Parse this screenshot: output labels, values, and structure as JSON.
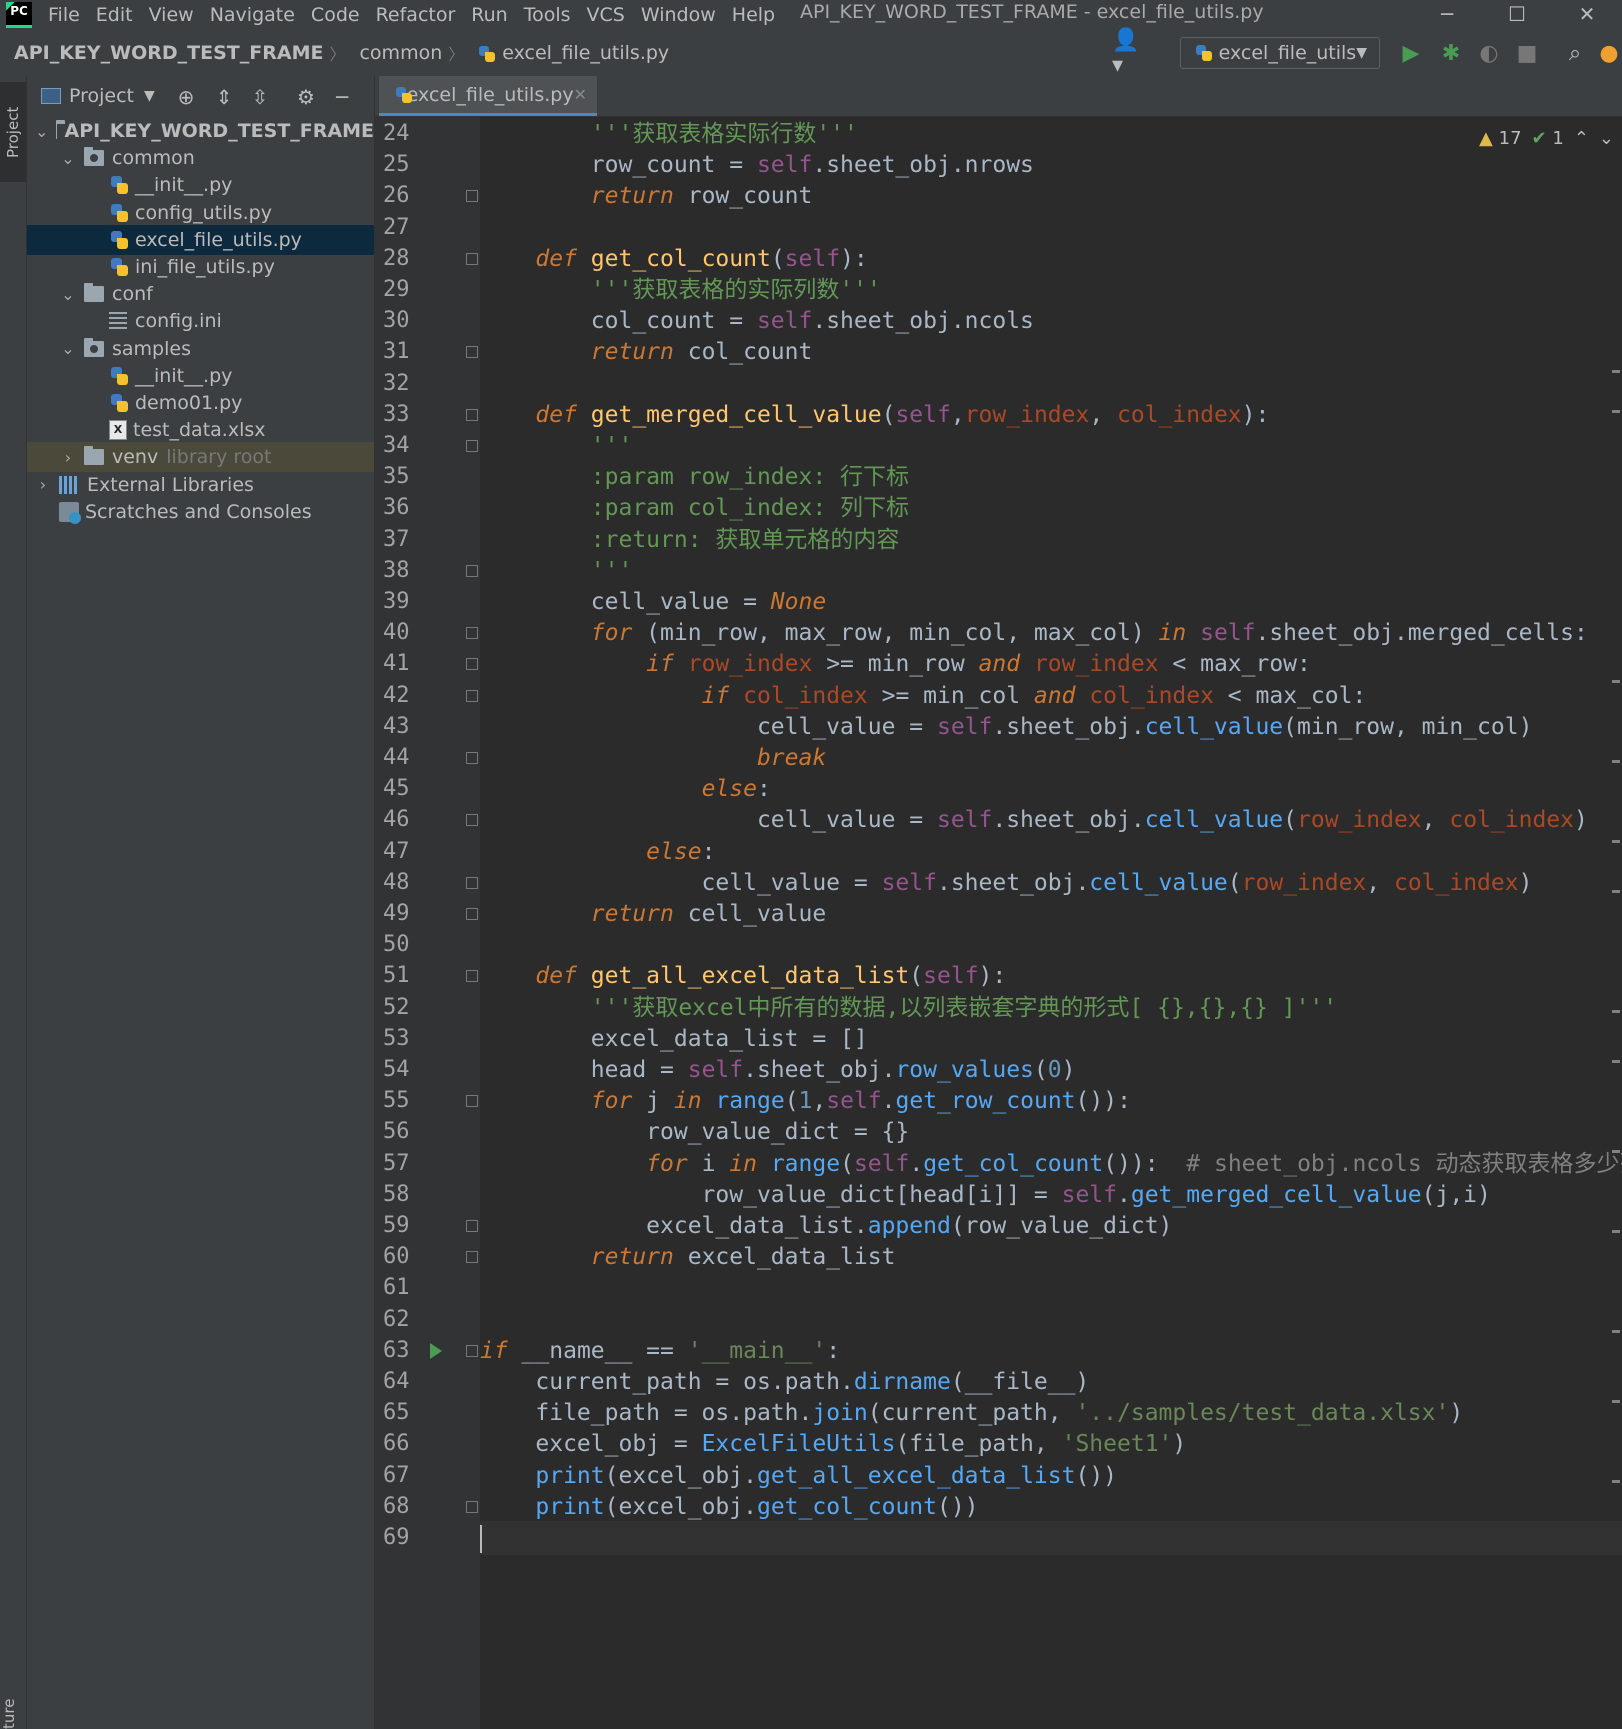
{
  "menu": {
    "items": [
      "File",
      "Edit",
      "View",
      "Navigate",
      "Code",
      "Refactor",
      "Run",
      "Tools",
      "VCS",
      "Window",
      "Help"
    ],
    "window_title": "API_KEY_WORD_TEST_FRAME - excel_file_utils.py"
  },
  "breadcrumb": {
    "project": "API_KEY_WORD_TEST_FRAME",
    "folder": "common",
    "file": "excel_file_utils.py"
  },
  "run_config": {
    "label": "excel_file_utils"
  },
  "project_panel": {
    "title": "Project",
    "tree": [
      {
        "label": "API_KEY_WORD_TEST_FRAME",
        "type": "root",
        "depth": 0,
        "expanded": true
      },
      {
        "label": "common",
        "type": "package",
        "depth": 1,
        "expanded": true
      },
      {
        "label": "__init__.py",
        "type": "py",
        "depth": 2
      },
      {
        "label": "config_utils.py",
        "type": "py",
        "depth": 2
      },
      {
        "label": "excel_file_utils.py",
        "type": "py",
        "depth": 2,
        "selected": true
      },
      {
        "label": "ini_file_utils.py",
        "type": "py",
        "depth": 2
      },
      {
        "label": "conf",
        "type": "folder",
        "depth": 1,
        "expanded": true
      },
      {
        "label": "config.ini",
        "type": "ini",
        "depth": 2
      },
      {
        "label": "samples",
        "type": "package",
        "depth": 1,
        "expanded": true
      },
      {
        "label": "__init__.py",
        "type": "py",
        "depth": 2
      },
      {
        "label": "demo01.py",
        "type": "py",
        "depth": 2
      },
      {
        "label": "test_data.xlsx",
        "type": "xlsx",
        "depth": 2
      },
      {
        "label": "venv",
        "type": "folder",
        "depth": 1,
        "expanded": false,
        "suffix": "library root",
        "highlight": true
      },
      {
        "label": "External Libraries",
        "type": "lib",
        "depth": 0,
        "expanded": false
      },
      {
        "label": "Scratches and Consoles",
        "type": "scratch",
        "depth": 0
      }
    ]
  },
  "tab": {
    "label": "excel_file_utils.py"
  },
  "inspections": {
    "warnings": "17",
    "ok": "1"
  },
  "left_strip": {
    "project_tab": "Project",
    "bottom_tab": "ture"
  },
  "editor": {
    "first_line": 24,
    "lines": [
      [
        [
          "doc",
          "        '''获取表格实际行数'''"
        ]
      ],
      [
        [
          "p",
          "        row_count = "
        ],
        [
          "self",
          "self"
        ],
        [
          "p",
          ".sheet_obj.nrows"
        ]
      ],
      [
        [
          "p",
          "        "
        ],
        [
          "kwi",
          "return"
        ],
        [
          "p",
          " row_count"
        ]
      ],
      [
        [
          "p",
          ""
        ]
      ],
      [
        [
          "p",
          "    "
        ],
        [
          "kwi",
          "def"
        ],
        [
          "p",
          " "
        ],
        [
          "fn",
          "get_col_count"
        ],
        [
          "p",
          "("
        ],
        [
          "self",
          "self"
        ],
        [
          "p",
          "):"
        ]
      ],
      [
        [
          "doc",
          "        '''获取表格的实际列数'''"
        ]
      ],
      [
        [
          "p",
          "        col_count = "
        ],
        [
          "self",
          "self"
        ],
        [
          "p",
          ".sheet_obj.ncols"
        ]
      ],
      [
        [
          "p",
          "        "
        ],
        [
          "kwi",
          "return"
        ],
        [
          "p",
          " col_count"
        ]
      ],
      [
        [
          "p",
          ""
        ]
      ],
      [
        [
          "p",
          "    "
        ],
        [
          "kwi",
          "def"
        ],
        [
          "p",
          " "
        ],
        [
          "fn",
          "get_merged_cell_value"
        ],
        [
          "p",
          "("
        ],
        [
          "self",
          "self"
        ],
        [
          "p",
          ","
        ],
        [
          "param",
          "row_index"
        ],
        [
          "p",
          ", "
        ],
        [
          "param",
          "col_index"
        ],
        [
          "p",
          "):"
        ]
      ],
      [
        [
          "doc",
          "        '''"
        ]
      ],
      [
        [
          "doc",
          "        :param row_index: 行下标"
        ]
      ],
      [
        [
          "doc",
          "        :param col_index: 列下标"
        ]
      ],
      [
        [
          "doc",
          "        :return: 获取单元格的内容"
        ]
      ],
      [
        [
          "doc",
          "        '''"
        ]
      ],
      [
        [
          "p",
          "        cell_value = "
        ],
        [
          "kwi",
          "None"
        ]
      ],
      [
        [
          "p",
          "        "
        ],
        [
          "kwi",
          "for"
        ],
        [
          "p",
          " (min_row, max_row, min_col, max_col) "
        ],
        [
          "kwi",
          "in"
        ],
        [
          "p",
          " "
        ],
        [
          "self",
          "self"
        ],
        [
          "p",
          ".sheet_obj.merged_cells:"
        ]
      ],
      [
        [
          "p",
          "            "
        ],
        [
          "kwi",
          "if"
        ],
        [
          "p",
          " "
        ],
        [
          "param",
          "row_index"
        ],
        [
          "p",
          " >= min_row "
        ],
        [
          "kwi",
          "and"
        ],
        [
          "p",
          " "
        ],
        [
          "param",
          "row_index"
        ],
        [
          "p",
          " < max_row:"
        ]
      ],
      [
        [
          "p",
          "                "
        ],
        [
          "kwi",
          "if"
        ],
        [
          "p",
          " "
        ],
        [
          "param",
          "col_index"
        ],
        [
          "p",
          " >= min_col "
        ],
        [
          "kwi",
          "and"
        ],
        [
          "p",
          " "
        ],
        [
          "param",
          "col_index"
        ],
        [
          "p",
          " < max_col:"
        ]
      ],
      [
        [
          "p",
          "                    cell_value = "
        ],
        [
          "self",
          "self"
        ],
        [
          "p",
          ".sheet_obj."
        ],
        [
          "call",
          "cell_value"
        ],
        [
          "p",
          "(min_row, min_col)"
        ]
      ],
      [
        [
          "p",
          "                    "
        ],
        [
          "kwi",
          "break"
        ]
      ],
      [
        [
          "p",
          "                "
        ],
        [
          "kwi",
          "else"
        ],
        [
          "p",
          ":"
        ]
      ],
      [
        [
          "p",
          "                    cell_value = "
        ],
        [
          "self",
          "self"
        ],
        [
          "p",
          ".sheet_obj."
        ],
        [
          "call",
          "cell_value"
        ],
        [
          "p",
          "("
        ],
        [
          "param",
          "row_index"
        ],
        [
          "p",
          ", "
        ],
        [
          "param",
          "col_index"
        ],
        [
          "p",
          ")"
        ]
      ],
      [
        [
          "p",
          "            "
        ],
        [
          "kwi",
          "else"
        ],
        [
          "p",
          ":"
        ]
      ],
      [
        [
          "p",
          "                cell_value = "
        ],
        [
          "self",
          "self"
        ],
        [
          "p",
          ".sheet_obj."
        ],
        [
          "call",
          "cell_value"
        ],
        [
          "p",
          "("
        ],
        [
          "param",
          "row_index"
        ],
        [
          "p",
          ", "
        ],
        [
          "param",
          "col_index"
        ],
        [
          "p",
          ")"
        ]
      ],
      [
        [
          "p",
          "        "
        ],
        [
          "kwi",
          "return"
        ],
        [
          "p",
          " cell_value"
        ]
      ],
      [
        [
          "p",
          ""
        ]
      ],
      [
        [
          "p",
          "    "
        ],
        [
          "kwi",
          "def"
        ],
        [
          "p",
          " "
        ],
        [
          "fn",
          "get_all_excel_data_list"
        ],
        [
          "p",
          "("
        ],
        [
          "self",
          "self"
        ],
        [
          "p",
          "):"
        ]
      ],
      [
        [
          "doc",
          "        '''获取excel中所有的数据,以列表嵌套字典的形式[ {},{},{} ]'''"
        ]
      ],
      [
        [
          "p",
          "        excel_data_list = []"
        ]
      ],
      [
        [
          "p",
          "        head = "
        ],
        [
          "self",
          "self"
        ],
        [
          "p",
          ".sheet_obj."
        ],
        [
          "call",
          "row_values"
        ],
        [
          "p",
          "("
        ],
        [
          "num",
          "0"
        ],
        [
          "p",
          ")"
        ]
      ],
      [
        [
          "p",
          "        "
        ],
        [
          "kwi",
          "for"
        ],
        [
          "p",
          " j "
        ],
        [
          "kwi",
          "in"
        ],
        [
          "p",
          " "
        ],
        [
          "call",
          "range"
        ],
        [
          "p",
          "("
        ],
        [
          "num",
          "1"
        ],
        [
          "p",
          ","
        ],
        [
          "self",
          "self"
        ],
        [
          "p",
          "."
        ],
        [
          "call",
          "get_row_count"
        ],
        [
          "p",
          "()):"
        ]
      ],
      [
        [
          "p",
          "            row_value_dict = {}"
        ]
      ],
      [
        [
          "p",
          "            "
        ],
        [
          "kwi",
          "for"
        ],
        [
          "p",
          " i "
        ],
        [
          "kwi",
          "in"
        ],
        [
          "p",
          " "
        ],
        [
          "call",
          "range"
        ],
        [
          "p",
          "("
        ],
        [
          "self",
          "self"
        ],
        [
          "p",
          "."
        ],
        [
          "call",
          "get_col_count"
        ],
        [
          "p",
          "()):  "
        ],
        [
          "cmt",
          "# sheet_obj.ncols 动态获取表格多少列"
        ]
      ],
      [
        [
          "p",
          "                row_value_dict[head[i]] = "
        ],
        [
          "self",
          "self"
        ],
        [
          "p",
          "."
        ],
        [
          "call",
          "get_merged_cell_value"
        ],
        [
          "p",
          "(j,i)"
        ]
      ],
      [
        [
          "p",
          "            excel_data_list."
        ],
        [
          "call",
          "append"
        ],
        [
          "p",
          "(row_value_dict)"
        ]
      ],
      [
        [
          "p",
          "        "
        ],
        [
          "kwi",
          "return"
        ],
        [
          "p",
          " excel_data_list"
        ]
      ],
      [
        [
          "p",
          ""
        ]
      ],
      [
        [
          "p",
          ""
        ]
      ],
      [
        [
          "kwi",
          "if"
        ],
        [
          "p",
          " __name__ == "
        ],
        [
          "str",
          "'__main__'"
        ],
        [
          "p",
          ":"
        ]
      ],
      [
        [
          "p",
          "    current_path = os.path."
        ],
        [
          "call",
          "dirname"
        ],
        [
          "p",
          "(__file__)"
        ]
      ],
      [
        [
          "p",
          "    file_path = os.path."
        ],
        [
          "call",
          "join"
        ],
        [
          "p",
          "(current_path, "
        ],
        [
          "str",
          "'../samples/test_data.xlsx'"
        ],
        [
          "p",
          ")"
        ]
      ],
      [
        [
          "p",
          "    excel_obj = "
        ],
        [
          "call",
          "ExcelFileUtils"
        ],
        [
          "p",
          "(file_path, "
        ],
        [
          "str",
          "'Sheet1'"
        ],
        [
          "p",
          ")"
        ]
      ],
      [
        [
          "p",
          "    "
        ],
        [
          "call",
          "print"
        ],
        [
          "p",
          "(excel_obj."
        ],
        [
          "call",
          "get_all_excel_data_list"
        ],
        [
          "p",
          "())"
        ]
      ],
      [
        [
          "p",
          "    "
        ],
        [
          "call",
          "print"
        ],
        [
          "p",
          "(excel_obj."
        ],
        [
          "call",
          "get_col_count"
        ],
        [
          "p",
          "())"
        ]
      ],
      [
        [
          "p",
          ""
        ]
      ]
    ]
  }
}
